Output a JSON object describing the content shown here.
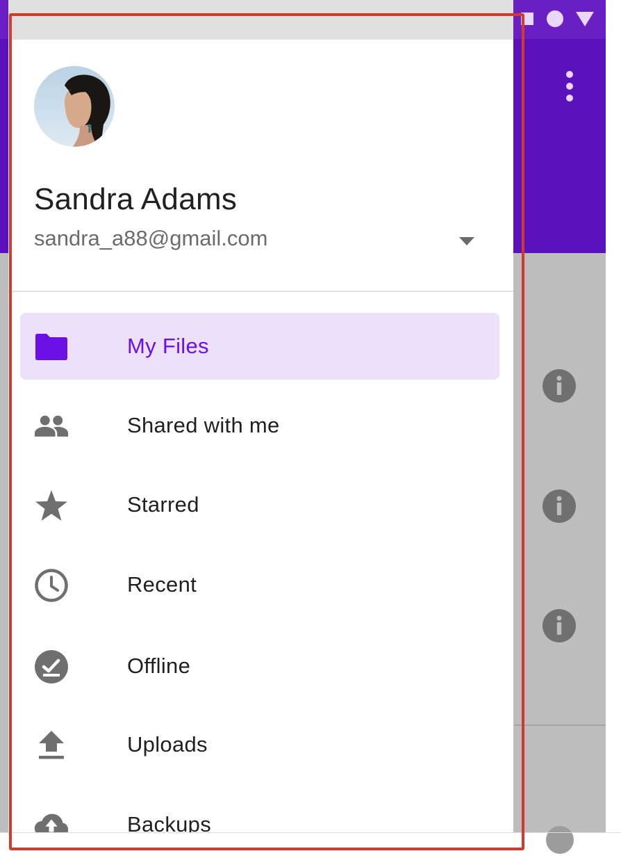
{
  "account": {
    "name": "Sandra Adams",
    "email": "sandra_a88@gmail.com"
  },
  "nav": {
    "items": [
      {
        "label": "My Files",
        "icon": "folder-icon",
        "active": true
      },
      {
        "label": "Shared with me",
        "icon": "people-icon",
        "active": false
      },
      {
        "label": "Starred",
        "icon": "star-icon",
        "active": false
      },
      {
        "label": "Recent",
        "icon": "clock-icon",
        "active": false
      },
      {
        "label": "Offline",
        "icon": "offline-check-icon",
        "active": false
      },
      {
        "label": "Uploads",
        "icon": "upload-icon",
        "active": false
      },
      {
        "label": "Backups",
        "icon": "cloud-upload-icon",
        "active": false
      }
    ]
  },
  "colors": {
    "accent": "#6b10e6",
    "active_background": "#ece0fb",
    "app_bar": "#5b12bd",
    "status_bar": "#6a1fc4",
    "scrim": "#bdbdbd",
    "icon_grey": "#6f6f6f",
    "annotation_frame": "#d23a2c"
  }
}
